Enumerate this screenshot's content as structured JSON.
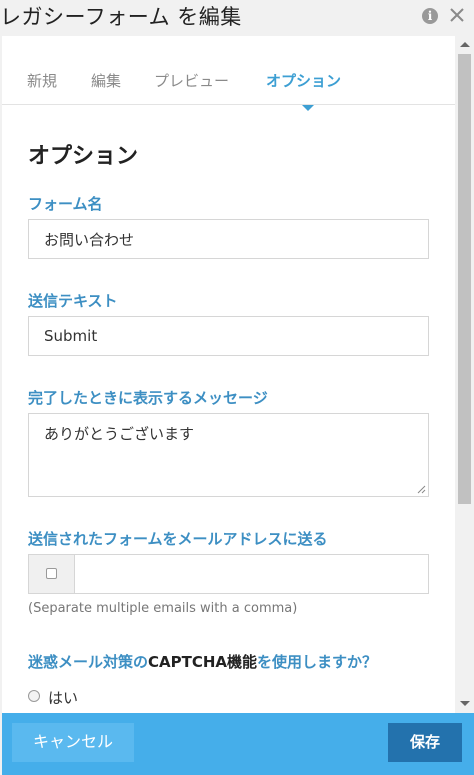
{
  "window": {
    "title": "レガシーフォーム を編集",
    "info_icon": "info-icon",
    "close_icon": "close-icon"
  },
  "tabs": [
    {
      "label": "新規",
      "active": false
    },
    {
      "label": "編集",
      "active": false
    },
    {
      "label": "プレビュー",
      "active": false
    },
    {
      "label": "オプション",
      "active": true
    }
  ],
  "section_heading": "オプション",
  "form_name": {
    "label": "フォーム名",
    "value": "お問い合わせ"
  },
  "submit_text": {
    "label": "送信テキスト",
    "value": "Submit"
  },
  "completion_message": {
    "label": "完了したときに表示するメッセージ",
    "value": "ありがとうございます"
  },
  "email_send": {
    "label": "送信されたフォームをメールアドレスに送る",
    "checked": false,
    "value": "",
    "hint": "(Separate multiple emails with a comma)"
  },
  "captcha": {
    "label_prefix": "迷惑メール対策の",
    "label_captcha": "CAPTCHA機能",
    "label_suffix": "を使用しますか？",
    "option_yes": "はい"
  },
  "footer": {
    "cancel_label": "キャンセル",
    "save_label": "保存"
  },
  "colors": {
    "accent": "#3d9fd3",
    "footer_bg": "#45aeea",
    "save_button": "#2372ad",
    "cancel_button": "#5ab9ef"
  }
}
